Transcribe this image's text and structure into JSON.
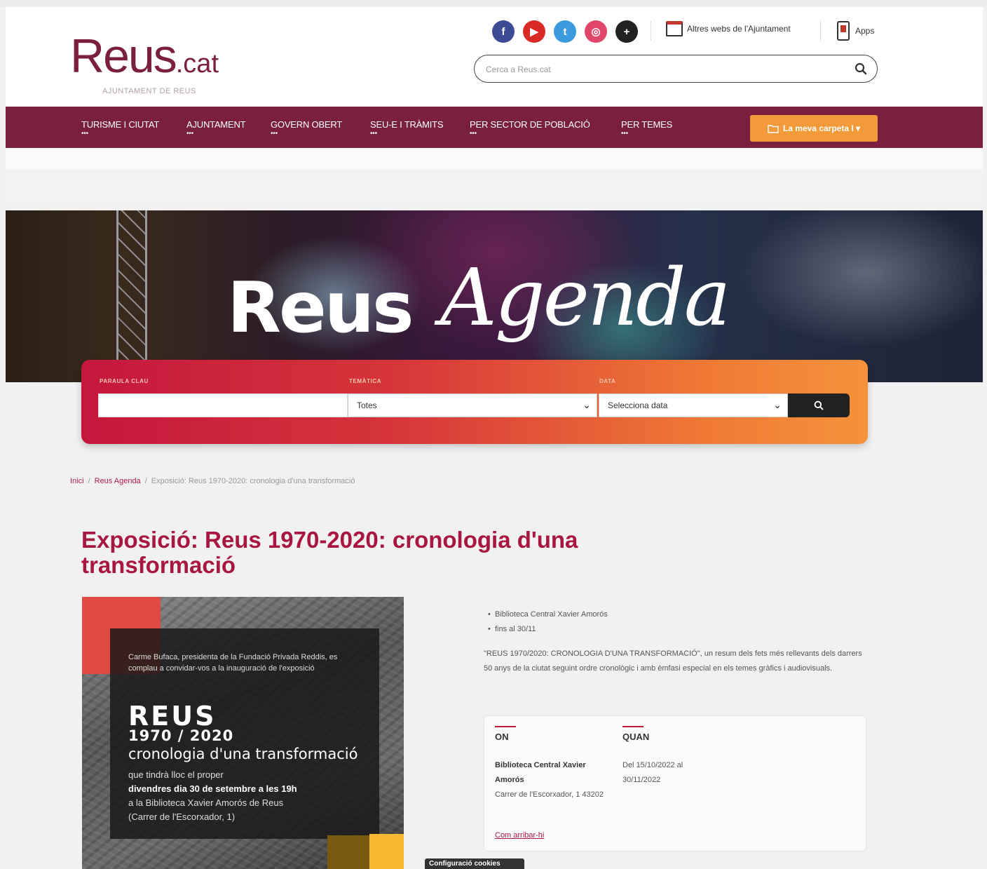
{
  "header": {
    "logo_main": "Reus",
    "logo_tld": ".cat",
    "logo_sub": "AJUNTAMENT DE REUS",
    "social": [
      {
        "name": "facebook-icon",
        "glyph": "f",
        "color": "#3b4c94"
      },
      {
        "name": "youtube-icon",
        "glyph": "▶",
        "color": "#d92a25"
      },
      {
        "name": "twitter-icon",
        "glyph": "t",
        "color": "#3b9bdd"
      },
      {
        "name": "instagram-icon",
        "glyph": "◎",
        "color": "#e0456a"
      },
      {
        "name": "more-icon",
        "glyph": "+",
        "color": "#222222"
      }
    ],
    "other_webs_label": "Altres webs de l'Ajuntament",
    "apps_label": "Apps",
    "search_placeholder": "Cerca a Reus.cat"
  },
  "nav": {
    "items": [
      "TURISME I CIUTAT",
      "AJUNTAMENT",
      "GOVERN OBERT",
      "SEU-E I TRÀMITS",
      "PER SECTOR DE POBLACIÓ",
      "PER TEMES"
    ],
    "dots": "•••",
    "folder_button": "La meva carpeta I ▾",
    "accent": "#7a1f3d",
    "folder_color": "#f39a3a"
  },
  "hero": {
    "word_1": "Reus",
    "word_2": "Agenda"
  },
  "filter": {
    "label_keyword": "PARAULA CLAU",
    "label_topic": "TEMÀTICA",
    "label_date": "DATA",
    "topic_value": "Totes",
    "date_value": "Selecciona data"
  },
  "breadcrumb": {
    "home": "Inici",
    "section": "Reus Agenda",
    "current": "Exposició: Reus 1970-2020: cronologia d'una transformació"
  },
  "event": {
    "title": "Exposició: Reus 1970-2020: cronologia d'una transformació",
    "bullets": [
      "Biblioteca Central Xavier Amorós",
      "fins al 30/11"
    ],
    "description": "\"REUS 1970/2020: CRONOLOGIA D'UNA TRANSFORMACIÓ\", un resum dels fets més rellevants dels darrers 50 anys de la ciutat seguint ordre cronològic i amb èmfasi especial en els temes gràfics i audiovisuals.",
    "where_heading": "ON",
    "where_place": "Biblioteca Central Xavier Amorós",
    "where_address": "Carrer de l'Escorxador, 1 43202",
    "when_heading": "QUAN",
    "when_value": "Del 15/10/2022 al 30/11/2022",
    "how_link": "Com arribar-hi"
  },
  "poster": {
    "intro": "Carme Bufaca, presidenta de la Fundació Privada Reddis, es complau a convidar-vos a la inauguració de l'exposició",
    "reus": "REUS",
    "years": "1970 / 2020",
    "crono": "cronologia d'una transformació",
    "line1": "que tindrà lloc el proper",
    "line2": "divendres dia 30 de setembre a les 19h",
    "line3": "a la Biblioteca Xavier Amorós de Reus",
    "line4": "(Carrer de l'Escorxador, 1)"
  },
  "cookies_label": "Configuració cookies"
}
